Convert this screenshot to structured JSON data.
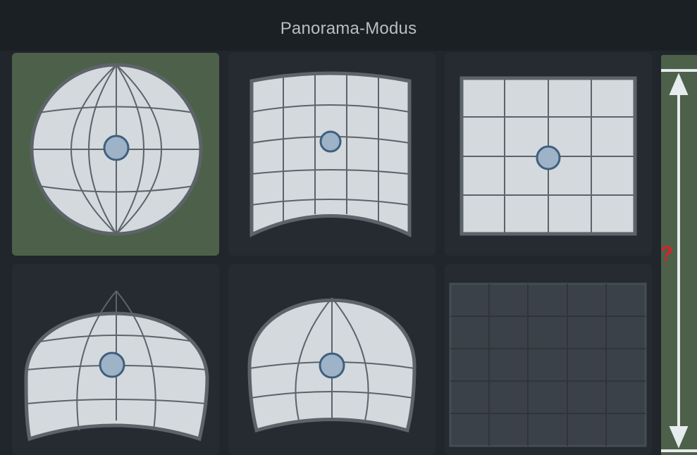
{
  "header": {
    "title": "Panorama-Modus"
  },
  "modes": [
    {
      "icon": "sphere-projection-icon",
      "selected": true
    },
    {
      "icon": "cylinder-projection-icon",
      "selected": false
    },
    {
      "icon": "flat-projection-icon",
      "selected": false
    },
    {
      "icon": "fisheye-projection-icon",
      "selected": false
    },
    {
      "icon": "dome-projection-icon",
      "selected": false
    },
    {
      "icon": "disabled-projection-icon",
      "selected": false
    }
  ],
  "side_bar": {
    "marker": "?"
  },
  "colors": {
    "selected_bg": "#4d6049",
    "tile_bg": "#252b31",
    "surface": "#d3d9dd",
    "outline": "#5c6469",
    "center_dot": "#9eb3c7",
    "center_dot_stroke": "#3f5f7e",
    "marker": "#d8232a"
  }
}
